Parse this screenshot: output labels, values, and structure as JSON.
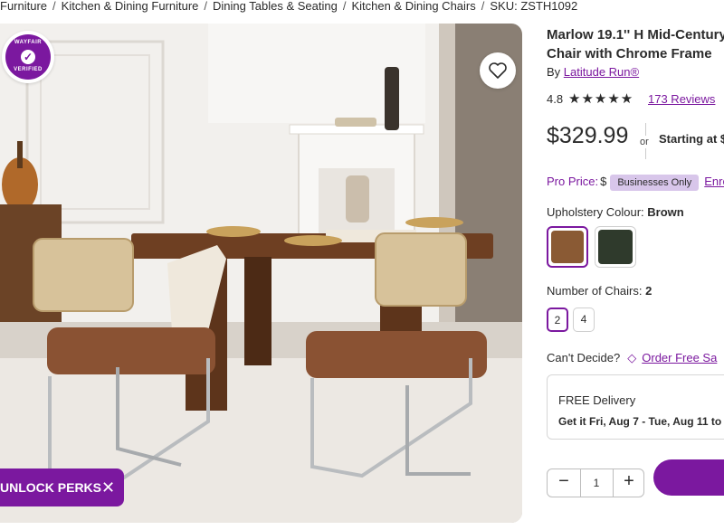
{
  "breadcrumb": {
    "items": [
      "Furniture",
      "Kitchen & Dining Furniture",
      "Dining Tables & Seating",
      "Kitchen & Dining Chairs"
    ],
    "sku": "SKU: ZSTH1092",
    "separator": "/"
  },
  "gallery": {
    "badge_top": "WAYFAIR",
    "badge_bottom": "VERIFIED",
    "perks_label": "UNLOCK PERKS",
    "perks_close": "✕"
  },
  "product": {
    "title_line1": "Marlow 19.1'' H Mid-Century",
    "title_line2": "Chair with Chrome Frame",
    "by_prefix": "By ",
    "brand": "Latitude Run®",
    "rating": "4.8",
    "stars": "★★★★★",
    "reviews": "173 Reviews",
    "price": "$329.99",
    "or": "or",
    "starting": "Starting at $",
    "pro_label": "Pro Price:",
    "pro_dollar": "$",
    "pro_pill": "Businesses Only",
    "enroll": "Enro",
    "upholstery_label": "Upholstery Colour: ",
    "upholstery_value": "Brown",
    "chairs_label": "Number of Chairs: ",
    "chairs_value": "2",
    "chair_options": [
      "2",
      "4"
    ],
    "cant_decide": "Can't Decide?",
    "order_sample": "Order Free Sa",
    "delivery_title": "FREE Delivery",
    "delivery_date": "Get it Fri, Aug 7 - Tue, Aug 11 to",
    "qty": "1",
    "minus": "−",
    "plus": "+"
  },
  "colors": {
    "accent": "#7b189f",
    "swatch_brown": "#8a5a34",
    "swatch_green": "#2f3a2c"
  }
}
